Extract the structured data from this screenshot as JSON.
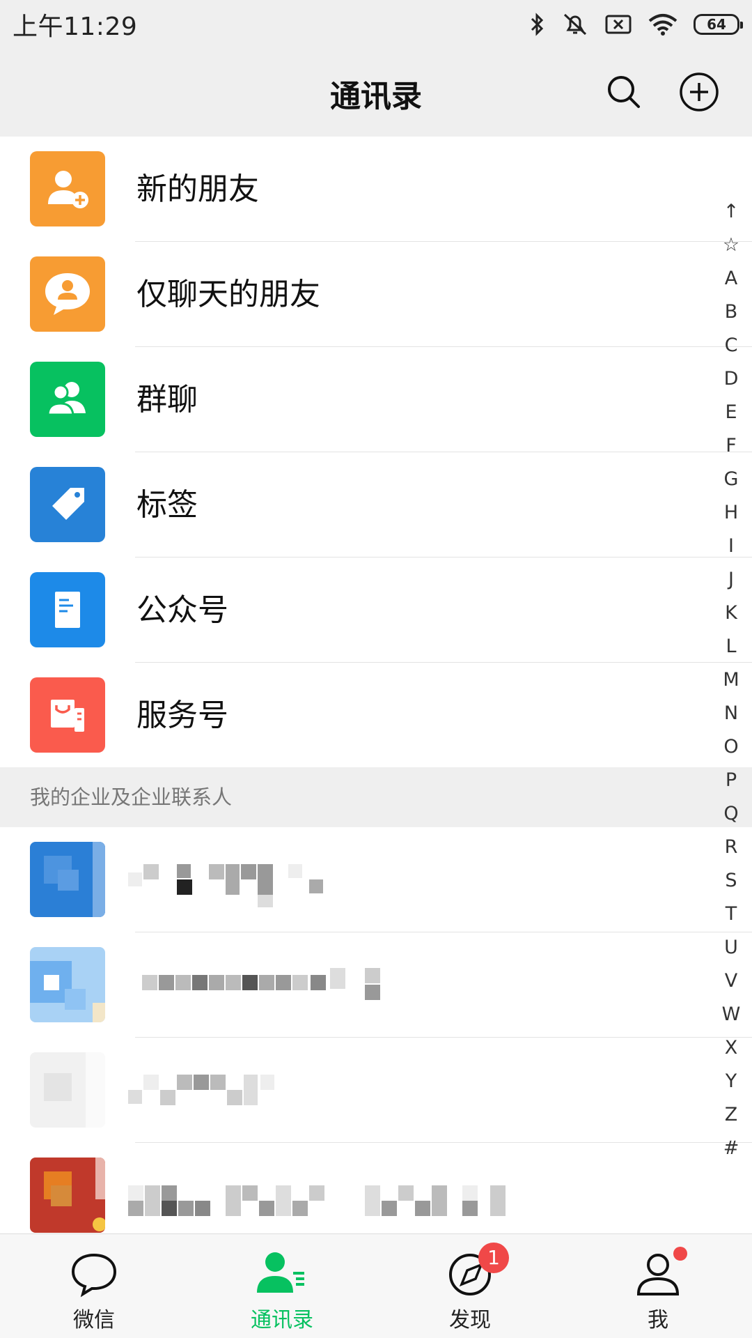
{
  "status_bar": {
    "time": "上午11:29",
    "battery": "64",
    "icons": [
      "bluetooth-icon",
      "mute-icon",
      "sim-x-icon",
      "wifi-icon",
      "battery-icon"
    ]
  },
  "header": {
    "title": "通讯录",
    "search_icon": "search-icon",
    "add_icon": "plus-circle-icon"
  },
  "functions": [
    {
      "label": "新的朋友",
      "icon": "add-friend-icon",
      "color": "#f79c33"
    },
    {
      "label": "仅聊天的朋友",
      "icon": "chat-only-friend-icon",
      "color": "#f79c33"
    },
    {
      "label": "群聊",
      "icon": "group-chat-icon",
      "color": "#07c160"
    },
    {
      "label": "标签",
      "icon": "tag-icon",
      "color": "#2782d7"
    },
    {
      "label": "公众号",
      "icon": "official-account-icon",
      "color": "#2782d7"
    },
    {
      "label": "服务号",
      "icon": "service-account-icon",
      "color": "#fa5b4d"
    }
  ],
  "section": {
    "enterprise_title": "我的企业及企业联系人"
  },
  "index_letters": [
    "↑",
    "☆",
    "A",
    "B",
    "C",
    "D",
    "E",
    "F",
    "G",
    "H",
    "I",
    "J",
    "K",
    "L",
    "M",
    "N",
    "O",
    "P",
    "Q",
    "R",
    "S",
    "T",
    "U",
    "V",
    "W",
    "X",
    "Y",
    "Z",
    "#"
  ],
  "tabs": [
    {
      "label": "微信",
      "icon": "chat-bubble-icon",
      "active": false
    },
    {
      "label": "通讯录",
      "icon": "contacts-icon",
      "active": true
    },
    {
      "label": "发现",
      "icon": "compass-icon",
      "active": false,
      "badge": "1"
    },
    {
      "label": "我",
      "icon": "person-icon",
      "active": false
    }
  ],
  "colors": {
    "accent": "#07c160",
    "header_bg": "#efefef",
    "badge": "#f04848"
  }
}
